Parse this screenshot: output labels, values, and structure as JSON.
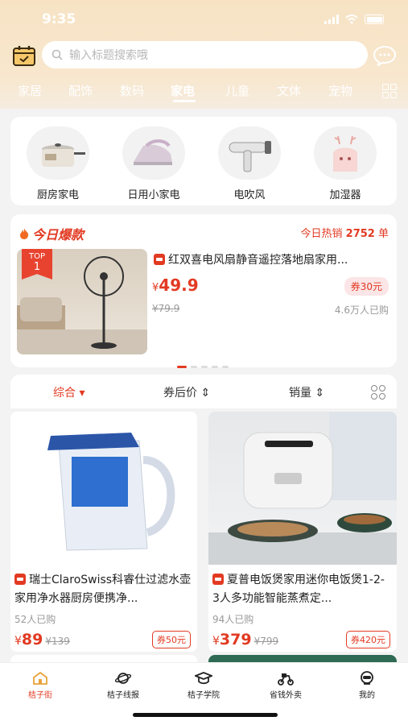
{
  "status": {
    "time": "9:35"
  },
  "search": {
    "placeholder": "输入标题搜索哦"
  },
  "tabs": [
    "家居",
    "配饰",
    "数码",
    "家电",
    "儿童",
    "文体",
    "宠物"
  ],
  "active_tab": "家电",
  "categories": [
    "厨房家电",
    "日用小家电",
    "电吹风",
    "加湿器"
  ],
  "hot": {
    "title": "今日爆款",
    "sales_prefix": "今日热销",
    "sales_count": "2752",
    "sales_unit": "单",
    "badge_top": "TOP",
    "badge_num": "1",
    "product_title": "红双喜电风扇静音遥控落地扇家用...",
    "price_symbol": "¥",
    "price": "49.9",
    "original_price": "¥79.9",
    "sold": "4.6万人已购",
    "coupon": "券30元"
  },
  "sort": {
    "comprehensive": "综合",
    "after_coupon": "券后价",
    "sales": "销量"
  },
  "products": [
    {
      "title": "瑞士ClaroSwiss科睿仕过滤水壶家用净水器厨房便携净...",
      "sold": "52人已购",
      "price_symbol": "¥",
      "price": "89",
      "original_price": "¥139",
      "coupon": "券50元"
    },
    {
      "title": "夏普电饭煲家用迷你电饭煲1-2-3人多功能智能蒸煮定...",
      "sold": "94人已购",
      "price_symbol": "¥",
      "price": "379",
      "original_price": "¥799",
      "coupon": "券420元"
    }
  ],
  "nav": [
    "桔子街",
    "桔子线报",
    "桔子学院",
    "省钱外卖",
    "我的"
  ],
  "colors": {
    "accent": "#e23a22",
    "header": "#f7e3c4"
  }
}
